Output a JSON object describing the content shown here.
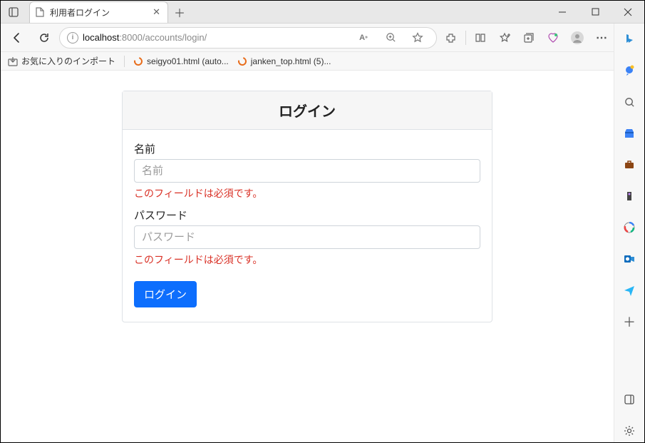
{
  "browser": {
    "tab_title": "利用者ログイン",
    "url_host": "localhost",
    "url_port_path": ":8000/accounts/login/",
    "bookmarks": {
      "import_label": "お気に入りのインポート",
      "item1": "seigyo01.html (auto...",
      "item2": "janken_top.html (5)..."
    }
  },
  "login": {
    "title": "ログイン",
    "name_label": "名前",
    "name_placeholder": "名前",
    "password_label": "パスワード",
    "password_placeholder": "パスワード",
    "required_error": "このフィールドは必須です。",
    "submit": "ログイン"
  }
}
